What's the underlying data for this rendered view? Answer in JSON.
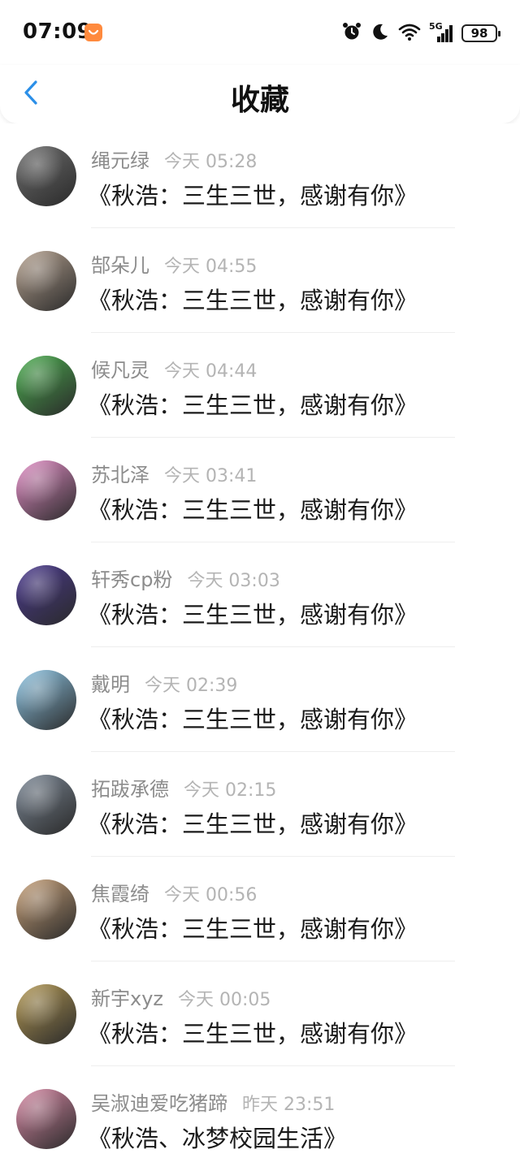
{
  "status_bar": {
    "time": "07:09",
    "battery": "98",
    "network": "5G",
    "icons": [
      "app-badge-icon",
      "alarm-icon",
      "moon-icon",
      "wifi-icon",
      "signal-icon",
      "battery-icon"
    ]
  },
  "header": {
    "title": "收藏",
    "back_icon": "chevron-left-icon",
    "accent_color": "#2b8fe8"
  },
  "favorites": [
    {
      "user": "绳元绿",
      "time": "今天 05:28",
      "title": "《秋浩：三生三世，感谢有你》",
      "avatar_color": "#6e6e6e"
    },
    {
      "user": "郜朵儿",
      "time": "今天 04:55",
      "title": "《秋浩：三生三世，感谢有你》",
      "avatar_color": "#b7a391"
    },
    {
      "user": "候凡灵",
      "time": "今天 04:44",
      "title": "《秋浩：三生三世，感谢有你》",
      "avatar_color": "#4caf50"
    },
    {
      "user": "苏北泽",
      "time": "今天 03:41",
      "title": "《秋浩：三生三世，感谢有你》",
      "avatar_color": "#e58fc8"
    },
    {
      "user": "轩秀cp粉",
      "time": "今天 03:03",
      "title": "《秋浩：三生三世，感谢有你》",
      "avatar_color": "#4b3a8f"
    },
    {
      "user": "戴明",
      "time": "今天 02:39",
      "title": "《秋浩：三生三世，感谢有你》",
      "avatar_color": "#8fc7e6"
    },
    {
      "user": "拓跋承德",
      "time": "今天 02:15",
      "title": "《秋浩：三生三世，感谢有你》",
      "avatar_color": "#7c8896"
    },
    {
      "user": "焦霞绮",
      "time": "今天 00:56",
      "title": "《秋浩：三生三世，感谢有你》",
      "avatar_color": "#c9a27a"
    },
    {
      "user": "新宇xyz",
      "time": "今天 00:05",
      "title": "《秋浩：三生三世，感谢有你》",
      "avatar_color": "#b59a55"
    },
    {
      "user": "吴淑迪爱吃猪蹄",
      "time": "昨天 23:51",
      "title": "《秋浩、冰梦校园生活》",
      "avatar_color": "#d98aa6"
    }
  ]
}
